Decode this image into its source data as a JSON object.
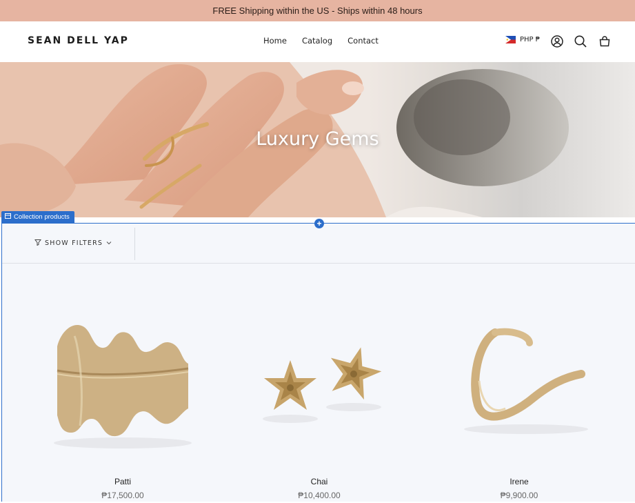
{
  "announcement": "FREE Shipping within the US - Ships within 48 hours",
  "header": {
    "logo": "SEAN DELL YAP",
    "nav": [
      "Home",
      "Catalog",
      "Contact"
    ],
    "currency": "PHP ₱",
    "icons": [
      "account-icon",
      "search-icon",
      "cart-icon"
    ]
  },
  "hero": {
    "title": "Luxury Gems"
  },
  "editor": {
    "section_label": "Collection products",
    "add_symbol": "+"
  },
  "filters": {
    "label": "SHOW FILTERS"
  },
  "products": [
    {
      "name": "Patti",
      "price": "₱17,500.00"
    },
    {
      "name": "Chai",
      "price": "₱10,400.00"
    },
    {
      "name": "Irene",
      "price": "₱9,900.00"
    }
  ],
  "colors": {
    "announcement_bg": "#e6b4a1",
    "editor_accent": "#2c6ecb",
    "section_bg": "#f5f7fb",
    "gold": "#c9a66b"
  }
}
